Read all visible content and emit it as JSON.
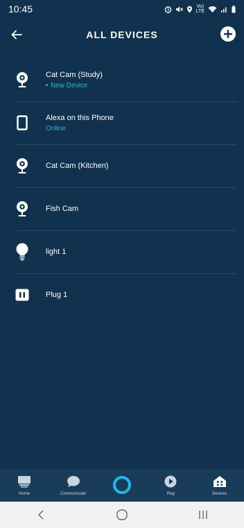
{
  "status_bar": {
    "time": "10:45"
  },
  "header": {
    "title": "ALL DEVICES"
  },
  "devices": [
    {
      "name": "Cat Cam (Study)",
      "status": "New Device",
      "icon": "camera-icon"
    },
    {
      "name": "Alexa on this Phone",
      "status": "Online",
      "icon": "phone-icon"
    },
    {
      "name": "Cat Cam (Kitchen)",
      "status": "",
      "icon": "camera-icon"
    },
    {
      "name": "Fish Cam",
      "status": "",
      "icon": "camera-icon"
    },
    {
      "name": "light 1",
      "status": "",
      "icon": "bulb-icon"
    },
    {
      "name": "Plug 1",
      "status": "",
      "icon": "plug-icon"
    }
  ],
  "bottom_nav": {
    "home": "Home",
    "communicate": "Communicate",
    "play": "Play",
    "devices": "Devices"
  },
  "colors": {
    "background": "#11324f",
    "nav_background": "#1a3c5b",
    "accent": "#22b7ec",
    "status_text": "#2fb5c7"
  }
}
